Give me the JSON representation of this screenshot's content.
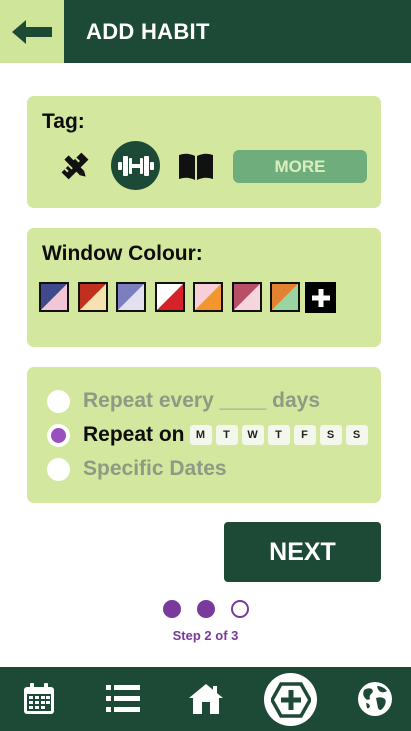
{
  "header": {
    "title": "ADD HABIT",
    "back_icon": "arrow-left-icon",
    "colors": {
      "bar": "#1d4a37",
      "back_bg": "#cfe59a",
      "back_arrow": "#1d4a37"
    }
  },
  "tag_section": {
    "heading": "Tag:",
    "icons": [
      "pencil-ruler-icon",
      "dumbbell-icon",
      "book-icon"
    ],
    "selected_icon": "dumbbell-icon",
    "more_label": "MORE"
  },
  "colour_section": {
    "heading": "Window Colour:",
    "swatches": [
      {
        "a": "#3f4a8c",
        "b": "#f2c6d6"
      },
      {
        "a": "#c0301f",
        "b": "#f6e2b0"
      },
      {
        "a": "#7b7fbf",
        "b": "#e3e0f1"
      },
      {
        "a": "#ffffff",
        "b": "#d8222a"
      },
      {
        "a": "#f7cfd9",
        "b": "#f3962d"
      },
      {
        "a": "#b84f68",
        "b": "#f6d6dc"
      },
      {
        "a": "#e0822f",
        "b": "#9bd4a3"
      }
    ],
    "add_icon": "plus-icon"
  },
  "repeat_section": {
    "options": [
      {
        "label": "Repeat every ____ days",
        "checked": false
      },
      {
        "label": "Repeat on",
        "checked": true
      },
      {
        "label": "Specific Dates",
        "checked": false
      }
    ],
    "days": [
      "M",
      "T",
      "W",
      "T",
      "F",
      "S",
      "S"
    ]
  },
  "next_label": "NEXT",
  "progress": {
    "current": 2,
    "total": 3,
    "text": "Step 2 of 3"
  },
  "bottom_nav": {
    "items": [
      "calendar-icon",
      "list-icon",
      "home-icon",
      "add-habit-icon",
      "globe-icon"
    ],
    "active": "add-habit-icon"
  }
}
